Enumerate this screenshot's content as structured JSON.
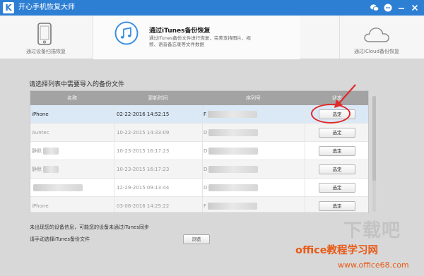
{
  "app": {
    "logo_letter": "K",
    "title": "开心手机恢复大师"
  },
  "titlebar_icons": [
    "wechat-icon",
    "chat-icon",
    "minimize-icon",
    "close-icon"
  ],
  "modes": {
    "device": {
      "label": "通过设备扫描恢复",
      "icon": "phone-icon"
    },
    "itunes": {
      "title": "通过iTunes备份恢复",
      "description": "通过iTunes备份文件进行恢复，完美支持图片、视频、语音备忘录等文件数据",
      "icon": "music-note-icon",
      "active": true
    },
    "icloud": {
      "label": "通过iCloud备份恢复",
      "icon": "cloud-icon"
    }
  },
  "prompt": "请选择列表中需要导入的备份文件",
  "table": {
    "columns": [
      "名称",
      "更新时间",
      "序列号",
      "状态"
    ],
    "rows": [
      {
        "name": "iPhone",
        "time": "02-22-2016 14:52:15",
        "serial": "F",
        "action": "选定",
        "selected": true
      },
      {
        "name": "Auntec",
        "time": "10-22-2015 14:33:09",
        "serial": "D",
        "action": "选定",
        "selected": false
      },
      {
        "name": "静默",
        "time": "10-23-2015 16:17:23",
        "serial": "D",
        "action": "选定",
        "selected": false
      },
      {
        "name": "静默",
        "time": "10-23-2015 16:17:23",
        "serial": "D",
        "action": "选定",
        "selected": false
      },
      {
        "name": "",
        "time": "12-29-2015 09:13:44",
        "serial": "D",
        "action": "选定",
        "selected": false
      },
      {
        "name": "iPhone",
        "time": "03-08-2016 14:25:22",
        "serial": "F",
        "action": "选定",
        "selected": false
      }
    ]
  },
  "footer": {
    "note1": "未出现您的设备信息，可能您的设备未通过iTunes同步",
    "note2": "请手动选择iTunes备份文件",
    "browse_label": "浏览"
  },
  "watermark": {
    "faint": "下载吧",
    "main": "office教程学习网",
    "url": "www.office68.com"
  },
  "colors": {
    "accent": "#2d7fd3",
    "annotation": "#e12a2a",
    "watermark": "#e85a16"
  }
}
